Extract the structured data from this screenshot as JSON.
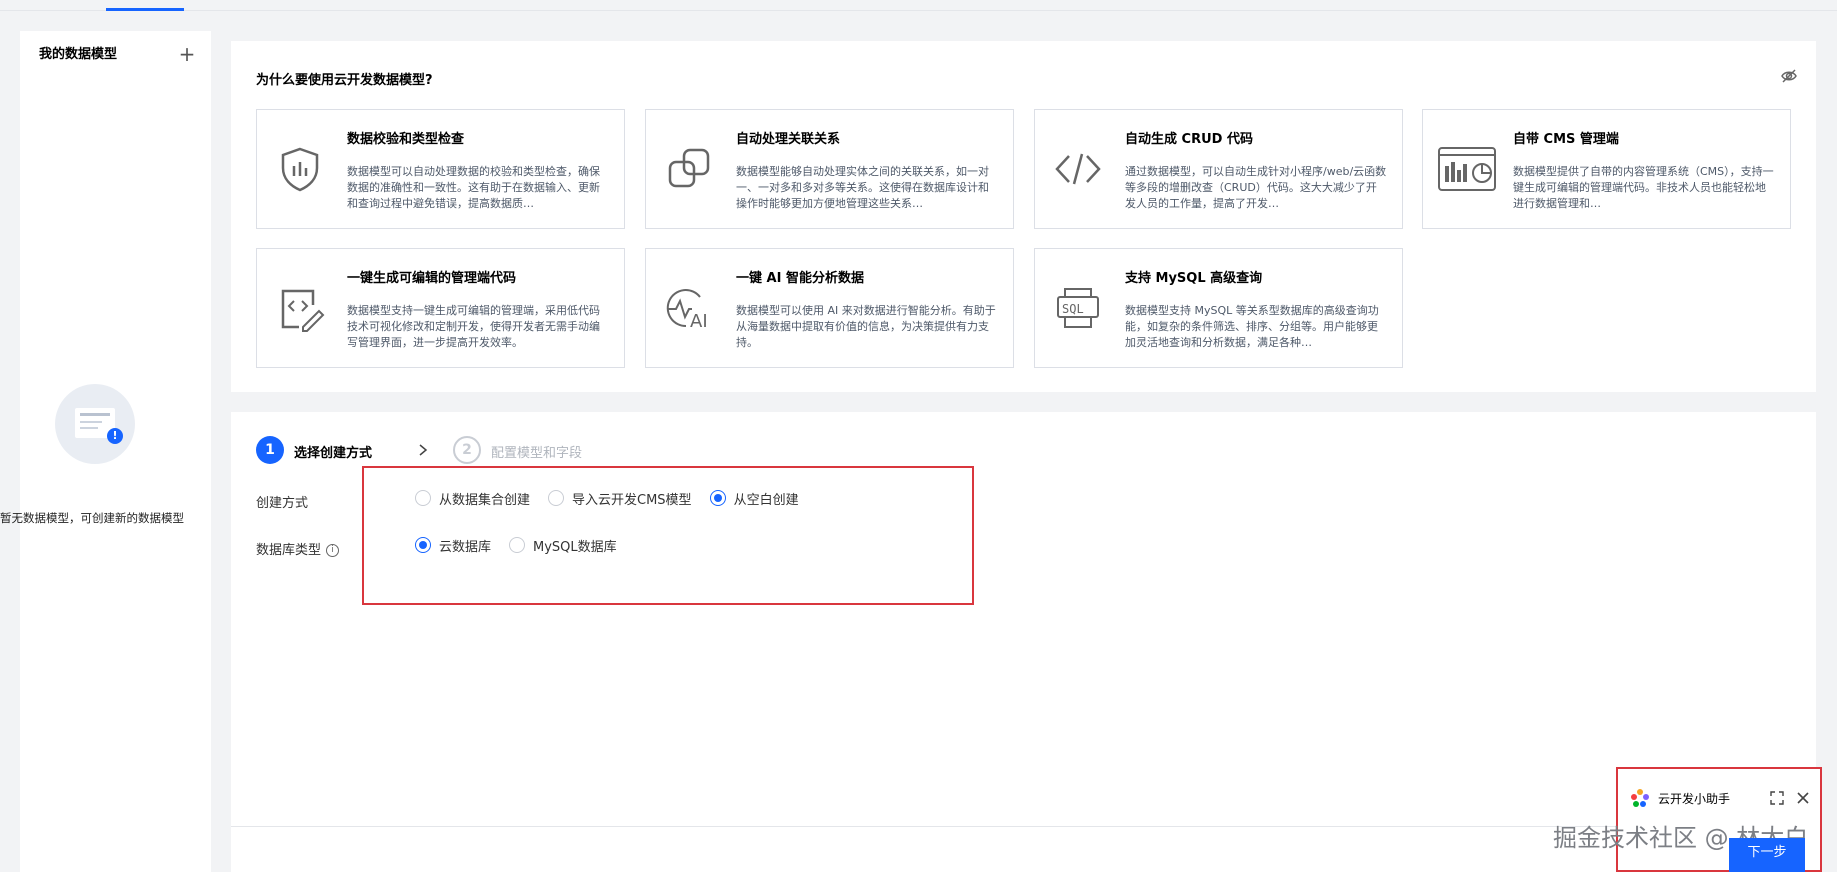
{
  "sidebar": {
    "title": "我的数据模型",
    "add_label": "+",
    "empty_text": "暂无数据模型，可创建新的数据模型",
    "empty_badge": "!"
  },
  "why": {
    "title": "为什么要使用云开发数据模型?",
    "cards": [
      {
        "title": "数据校验和类型检查",
        "desc": "数据模型可以自动处理数据的校验和类型检查，确保数据的准确性和一致性。这有助于在数据输入、更新和查询过程中避免错误，提高数据质…",
        "icon": "shield-icon"
      },
      {
        "title": "自动处理关联关系",
        "desc": "数据模型能够自动处理实体之间的关联关系，如一对一、一对多和多对多等关系。这使得在数据库设计和操作时能够更加方便地管理这些关系…",
        "icon": "link-copy-icon"
      },
      {
        "title": "自动生成 CRUD 代码",
        "desc": "通过数据模型，可以自动生成针对小程序/web/云函数等多段的增删改查（CRUD）代码。这大大减少了开发人员的工作量，提高了开发…",
        "icon": "code-icon"
      },
      {
        "title": "自带 CMS 管理端",
        "desc": "数据模型提供了自带的内容管理系统（CMS），支持一键生成可编辑的管理端代码。非技术人员也能轻松地进行数据管理和…",
        "icon": "dashboard-icon"
      },
      {
        "title": "一键生成可编辑的管理端代码",
        "desc": "数据模型支持一键生成可编辑的管理端，采用低代码技术可视化修改和定制开发，使得开发者无需手动编写管理界面，进一步提高开发效率。",
        "icon": "edit-code-icon"
      },
      {
        "title": "一键 AI 智能分析数据",
        "desc": "数据模型可以使用 AI 来对数据进行智能分析。有助于从海量数据中提取有价值的信息，为决策提供有力支持。",
        "icon": "ai-analysis-icon"
      },
      {
        "title": "支持 MySQL 高级查询",
        "desc": "数据模型支持 MySQL 等关系型数据库的高级查询功能，如复杂的条件筛选、排序、分组等。用户能够更加灵活地查询和分析数据，满足各种…",
        "icon": "sql-icon"
      }
    ]
  },
  "steps": [
    {
      "num": "1",
      "label": "选择创建方式"
    },
    {
      "num": "2",
      "label": "配置模型和字段"
    }
  ],
  "form": {
    "create_method_label": "创建方式",
    "create_options": [
      "从数据集合创建",
      "导入云开发CMS模型",
      "从空白创建"
    ],
    "db_type_label": "数据库类型",
    "db_options": [
      "云数据库",
      "MySQL数据库"
    ],
    "info_glyph": "i"
  },
  "assistant": {
    "title": "云开发小助手"
  },
  "next_button": "下一步",
  "watermark": "掘金技术社区 @ 林太白",
  "colors": {
    "accent": "#1664ff",
    "highlight": "#d9363e"
  }
}
